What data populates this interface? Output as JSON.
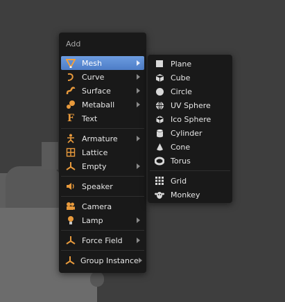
{
  "add_menu": {
    "title": "Add",
    "items": [
      {
        "label": "Mesh",
        "icon": "mesh-icon",
        "submenu": true
      },
      {
        "label": "Curve",
        "icon": "curve-icon",
        "submenu": true
      },
      {
        "label": "Surface",
        "icon": "surface-icon",
        "submenu": true
      },
      {
        "label": "Metaball",
        "icon": "metaball-icon",
        "submenu": true
      },
      {
        "label": "Text",
        "icon": "text-icon",
        "submenu": false
      },
      {
        "label": "Armature",
        "icon": "armature-icon",
        "submenu": true
      },
      {
        "label": "Lattice",
        "icon": "lattice-icon",
        "submenu": false
      },
      {
        "label": "Empty",
        "icon": "empty-icon",
        "submenu": true
      },
      {
        "label": "Speaker",
        "icon": "speaker-icon",
        "submenu": false
      },
      {
        "label": "Camera",
        "icon": "camera-icon",
        "submenu": false
      },
      {
        "label": "Lamp",
        "icon": "lamp-icon",
        "submenu": true
      },
      {
        "label": "Force Field",
        "icon": "force-field-icon",
        "submenu": true
      },
      {
        "label": "Group Instance",
        "icon": "group-instance-icon",
        "submenu": true
      }
    ]
  },
  "mesh_submenu": {
    "items": [
      {
        "label": "Plane",
        "icon": "plane-icon"
      },
      {
        "label": "Cube",
        "icon": "cube-icon"
      },
      {
        "label": "Circle",
        "icon": "circle-icon"
      },
      {
        "label": "UV Sphere",
        "icon": "uv-sphere-icon"
      },
      {
        "label": "Ico Sphere",
        "icon": "ico-sphere-icon"
      },
      {
        "label": "Cylinder",
        "icon": "cylinder-icon"
      },
      {
        "label": "Cone",
        "icon": "cone-icon"
      },
      {
        "label": "Torus",
        "icon": "torus-icon"
      },
      {
        "label": "Grid",
        "icon": "grid-icon"
      },
      {
        "label": "Monkey",
        "icon": "monkey-icon"
      }
    ]
  },
  "colors": {
    "menu_bg": "#191919",
    "highlight": "#5680c2",
    "icon_orange": "#e89a3c"
  }
}
